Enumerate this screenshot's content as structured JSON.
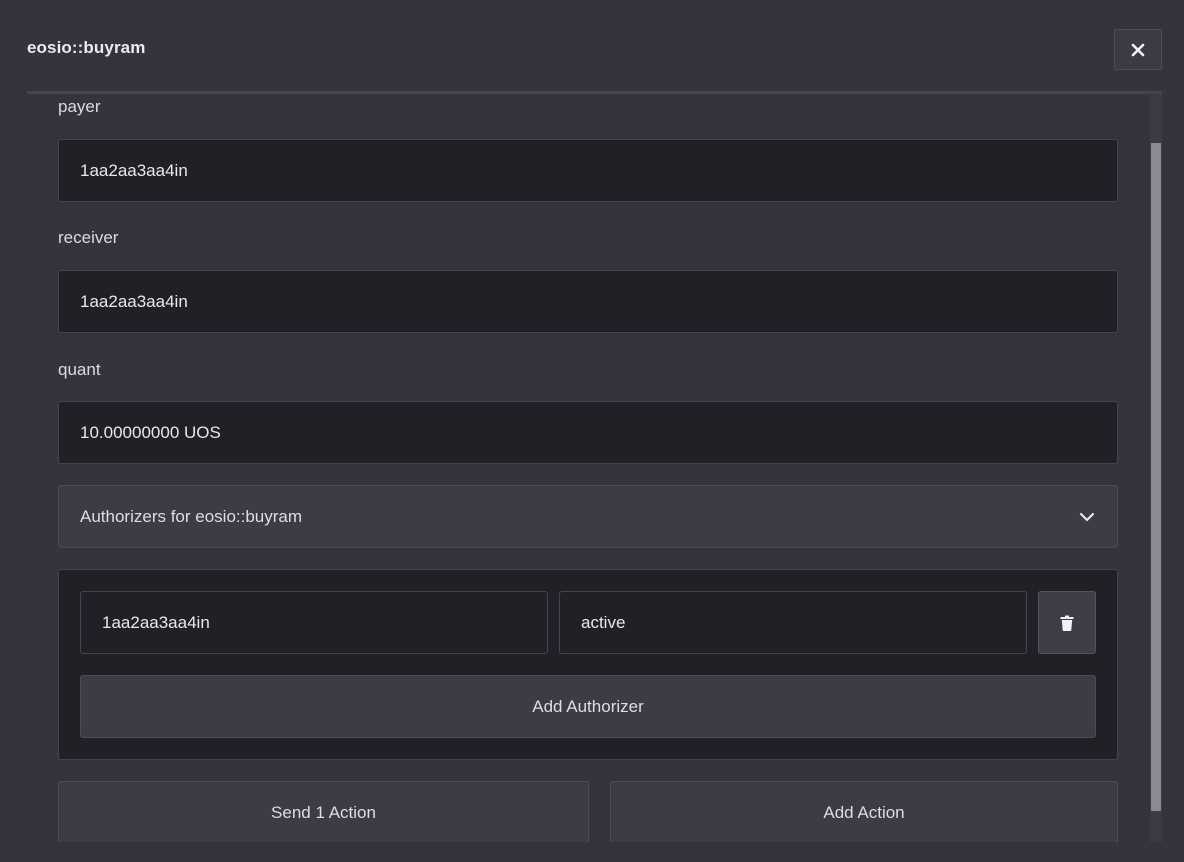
{
  "dialog": {
    "title": "eosio::buyram",
    "close_icon": "close-icon"
  },
  "fields": {
    "payer": {
      "label": "payer",
      "value": "1aa2aa3aa4in"
    },
    "receiver": {
      "label": "receiver",
      "value": "1aa2aa3aa4in"
    },
    "quant": {
      "label": "quant",
      "value": "10.00000000 UOS"
    }
  },
  "authorizers": {
    "accordion_label": "Authorizers for eosio::buyram",
    "chevron_icon": "chevron-down-icon",
    "rows": [
      {
        "actor": "1aa2aa3aa4in",
        "permission": "active",
        "delete_icon": "trash-icon"
      }
    ],
    "add_label": "Add Authorizer"
  },
  "actions": {
    "send_label": "Send 1 Action",
    "add_label": "Add Action"
  },
  "colors": {
    "background": "#35333c",
    "input_bg": "#212026",
    "button_bg": "#3d3b45",
    "scroll_thumb": "#8b8a90"
  }
}
